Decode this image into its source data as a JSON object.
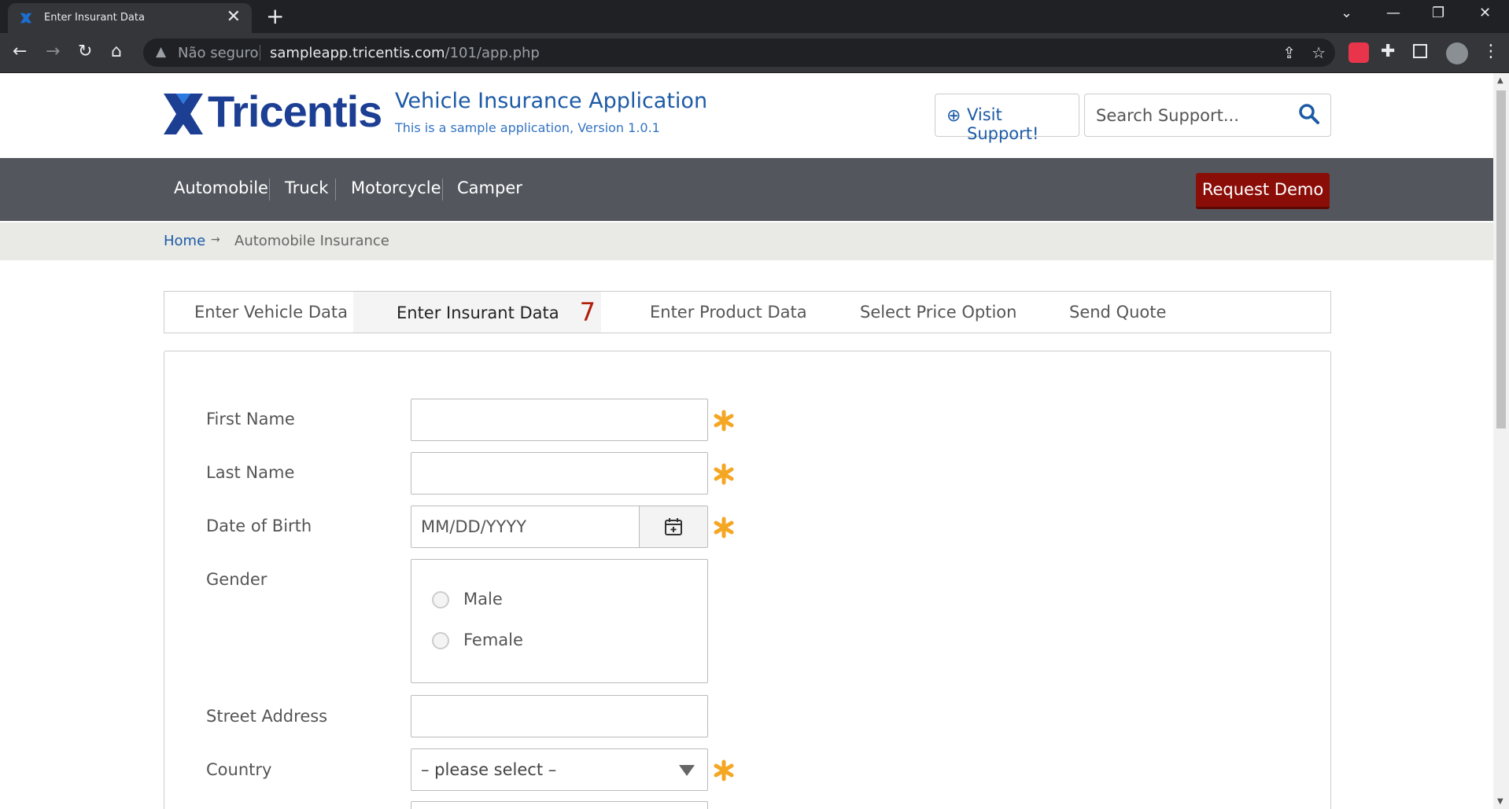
{
  "browser": {
    "tab_title": "Enter Insurant Data",
    "tab_close": "✕",
    "new_tab": "+",
    "security_label": "Não seguro",
    "url_host": "sampleapp.tricentis.com",
    "url_path": "/101/app.php"
  },
  "header": {
    "logo_text": "Tricentis",
    "app_title": "Vehicle Insurance Application",
    "app_subtitle": "This is a sample application, Version 1.0.1",
    "support_button": "Visit Support!",
    "search_placeholder": "Search Support..."
  },
  "nav": {
    "items": [
      "Automobile",
      "Truck",
      "Motorcycle",
      "Camper"
    ],
    "demo_button": "Request Demo"
  },
  "breadcrumb": {
    "home": "Home",
    "arrow": "→",
    "current": "Automobile Insurance"
  },
  "steps": [
    {
      "label": "Enter Vehicle Data",
      "active": false
    },
    {
      "label": "Enter Insurant Data",
      "active": true,
      "count": "7"
    },
    {
      "label": "Enter Product Data",
      "active": false
    },
    {
      "label": "Select Price Option",
      "active": false
    },
    {
      "label": "Send Quote",
      "active": false
    }
  ],
  "form": {
    "first_name_label": "First Name",
    "last_name_label": "Last Name",
    "dob_label": "Date of Birth",
    "dob_placeholder": "MM/DD/YYYY",
    "gender_label": "Gender",
    "gender_male": "Male",
    "gender_female": "Female",
    "street_label": "Street Address",
    "country_label": "Country",
    "country_value": "– please select –"
  },
  "colors": {
    "brand_blue": "#1c3f94",
    "nav_bg": "#53575d",
    "demo_red": "#8a0d08",
    "required_orange": "#f5a623"
  }
}
